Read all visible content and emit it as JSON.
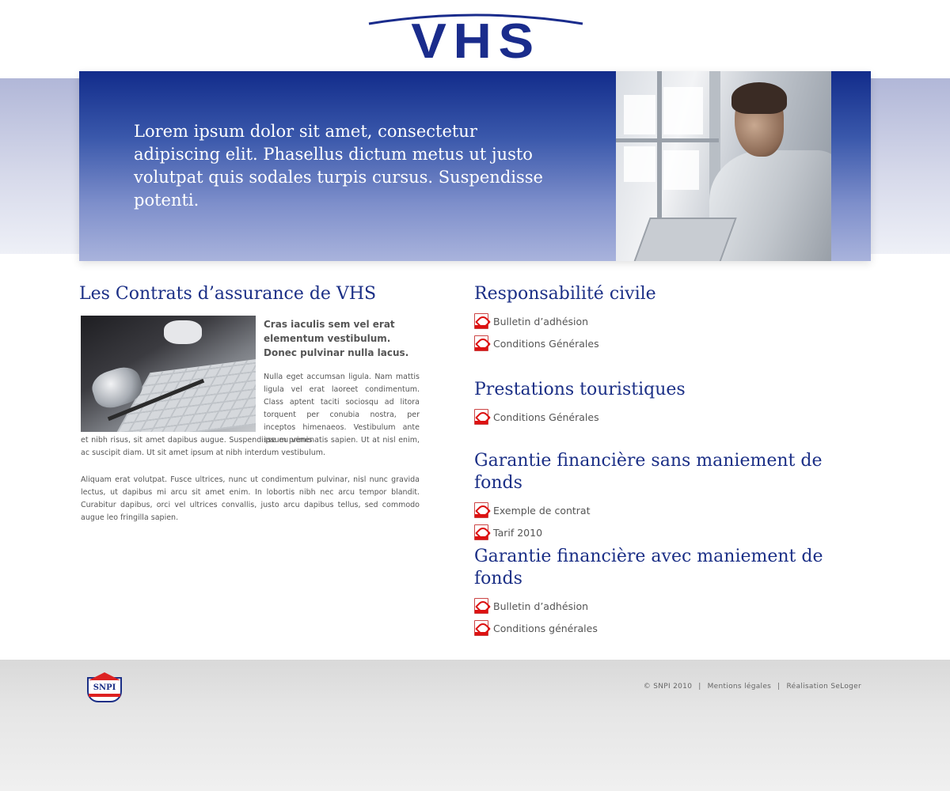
{
  "brand": {
    "logo_text": "VHS"
  },
  "hero": {
    "text": "Lorem ipsum dolor sit amet, consectetur adipiscing elit. Phasellus dictum metus ut justo volutpat quis sodales turpis cursus. Suspendisse potenti."
  },
  "left": {
    "title": "Les Contrats d’assurance de VHS",
    "intro": "Cras iaculis sem vel erat elementum vestibulum. Donec pulvinar nulla lacus.",
    "body1": "Nulla eget accumsan ligula. Nam mattis ligula vel erat laoreet condimentum. Class aptent taciti sociosqu ad litora torquent per conubia nostra, per inceptos himenaeos. Vestibulum ante ipsum primis",
    "body1b": "et nibh risus, sit amet dapibus augue. Suspendisse eu venenatis sapien. Ut at nisl enim, ac suscipit diam. Ut sit amet ipsum at nibh interdum vestibulum.",
    "body2": "Aliquam erat volutpat. Fusce ultrices, nunc ut condimentum pulvinar, nisl nunc gravida lectus, ut dapibus mi arcu sit amet enim. In lobortis nibh nec arcu tempor blandit. Curabitur dapibus, orci vel ultrices convallis, justo arcu dapibus tellus, sed commodo augue leo fringilla sapien."
  },
  "sections": [
    {
      "title": "Responsabilité civile",
      "docs": [
        "Bulletin d’adhésion",
        "Conditions Générales"
      ]
    },
    {
      "title": "Prestations touristiques",
      "docs": [
        "Conditions Générales"
      ]
    },
    {
      "title": "Garantie financière sans maniement de fonds",
      "docs": [
        "Exemple de contrat",
        "Tarif 2010"
      ]
    },
    {
      "title": "Garantie financière avec maniement de fonds",
      "docs": [
        "Bulletin d’adhésion",
        "Conditions générales"
      ]
    }
  ],
  "footer": {
    "logo_text": "SNPI",
    "copyright": "© SNPI 2010",
    "legal": "Mentions légales",
    "credit": "Réalisation SeLoger",
    "separator": "|"
  },
  "colors": {
    "brand_blue": "#1b2f86",
    "pdf_red": "#d11111"
  }
}
